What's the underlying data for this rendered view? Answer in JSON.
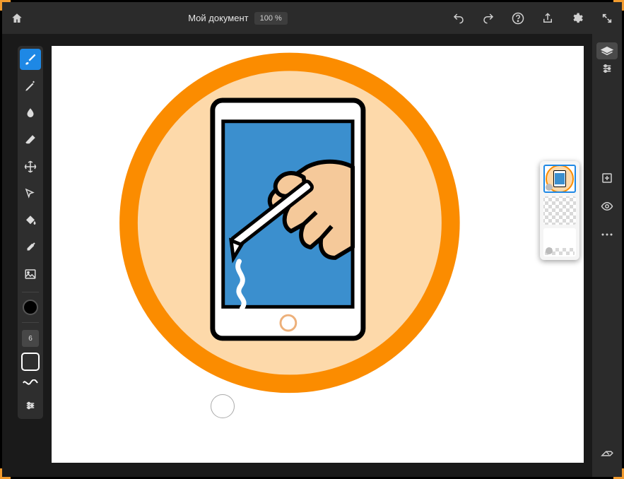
{
  "header": {
    "title": "Мой документ",
    "zoom": "100 %"
  },
  "brush": {
    "size_label": "6"
  },
  "colors": {
    "accent": "#1e88e5",
    "stroke": "#000000"
  },
  "layers": {
    "active": 0,
    "count": 3
  }
}
